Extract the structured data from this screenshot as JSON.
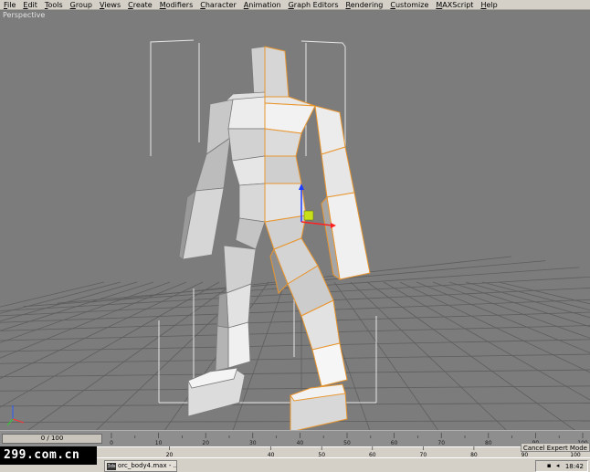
{
  "menubar": {
    "items": [
      "File",
      "Edit",
      "Tools",
      "Group",
      "Views",
      "Create",
      "Modifiers",
      "Character",
      "Animation",
      "Graph Editors",
      "Rendering",
      "Customize",
      "MAXScript",
      "Help"
    ]
  },
  "viewport": {
    "label": "Perspective"
  },
  "timeline": {
    "slider_text": "0 / 100",
    "ticks": [
      "0",
      "10",
      "20",
      "30",
      "40",
      "50",
      "60",
      "70",
      "80",
      "90",
      "100"
    ]
  },
  "statusbar": {
    "watermark": "299.com.cn",
    "expert_mode": "Cancel Expert Mode",
    "ruler_ticks": [
      "20",
      "40",
      "50",
      "60",
      "70",
      "80",
      "90",
      "100"
    ]
  },
  "taskbar": {
    "task_label": "orc_body4.max - ...",
    "task_icon": "3ds",
    "clock": "18:42"
  },
  "colors": {
    "viewport_bg": "#7c7c7c",
    "mesh_fill": "#d8d8d8",
    "selection_edge": "#e8952e",
    "grid": "#5a5a5a"
  }
}
